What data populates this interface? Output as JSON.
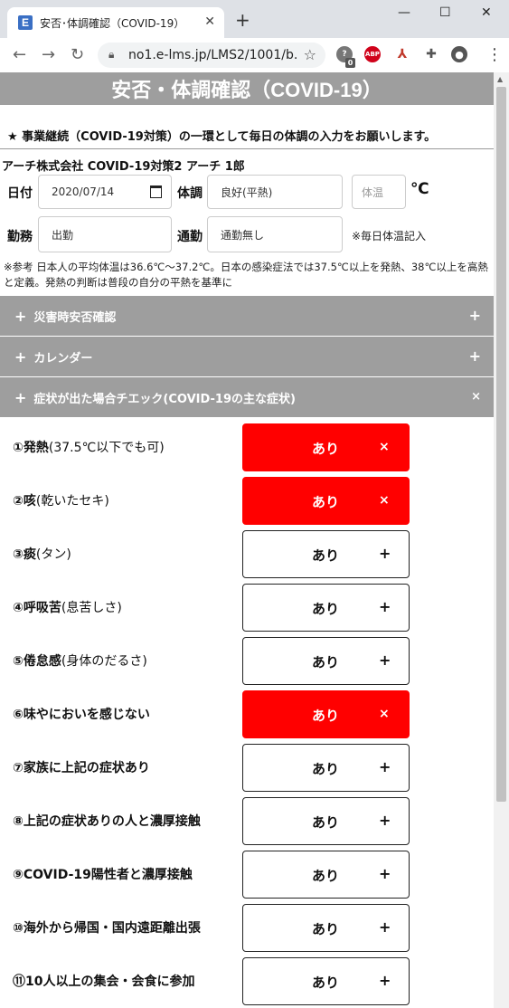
{
  "browser": {
    "tab_title": "安否･体調確認（COVID-19）",
    "favicon_letter": "E",
    "url": "no1.e-lms.jp/LMS2/1001/b...",
    "ext_badge": "0",
    "abp": "ABP"
  },
  "page": {
    "title": "安否・体調確認（COVID-19）",
    "notice": "★ 事業継続（COVID-19対策）の一環として毎日の体調の入力をお願いします。",
    "user_line": "アーチ株式会社 COVID-19対策2 アーチ 1郎",
    "form": {
      "date_label": "日付",
      "date_value": "2020/07/14",
      "condition_label": "体調",
      "condition_value": "良好(平熱)",
      "temp_placeholder": "体温",
      "temp_unit": "℃",
      "work_label": "勤務",
      "work_value": "出勤",
      "commute_label": "通勤",
      "commute_value": "通勤無し",
      "daily_note": "※毎日体温記入"
    },
    "reference": "※参考 日本人の平均体温は36.6℃～37.2℃。日本の感染症法では37.5℃以上を発熱、38℃以上を高熱と定義。発熱の判断は普段の自分の平熱を基準に",
    "accordions": [
      {
        "label": "災害時安否確認",
        "toggle": "+"
      },
      {
        "label": "カレンダー",
        "toggle": "+"
      },
      {
        "label": "症状が出た場合チエック(COVID-19の主な症状)",
        "toggle": "×"
      }
    ],
    "accordion_prefix": "+",
    "symptom_button_label": "あり",
    "symptoms": [
      {
        "main": "①発熱",
        "sub": "(37.5℃以下でも可)",
        "active": true,
        "icon": "×"
      },
      {
        "main": "②咳",
        "sub": "(乾いたセキ)",
        "active": true,
        "icon": "×"
      },
      {
        "main": "③痰",
        "sub": "(タン)",
        "active": false,
        "icon": "+"
      },
      {
        "main": "④呼吸苦",
        "sub": "(息苦しさ)",
        "active": false,
        "icon": "+"
      },
      {
        "main": "⑤倦怠感",
        "sub": "(身体のだるさ)",
        "active": false,
        "icon": "+"
      },
      {
        "main": "⑥味やにおいを感じない",
        "sub": "",
        "active": true,
        "icon": "×"
      },
      {
        "main": "⑦家族に上記の症状あり",
        "sub": "",
        "active": false,
        "icon": "+"
      },
      {
        "main": "⑧上記の症状ありの人と濃厚接触",
        "sub": "",
        "active": false,
        "icon": "+"
      },
      {
        "main": "⑨COVID-19陽性者と濃厚接触",
        "sub": "",
        "active": false,
        "icon": "+"
      },
      {
        "main": "⑩海外から帰国・国内遠距離出張",
        "sub": "",
        "active": false,
        "icon": "+"
      },
      {
        "main": "⑪10人以上の集会・会食に参加",
        "sub": "",
        "active": false,
        "icon": "+"
      }
    ]
  },
  "colors": {
    "active_red": "#ff0000",
    "header_gray": "#9e9e9e"
  }
}
